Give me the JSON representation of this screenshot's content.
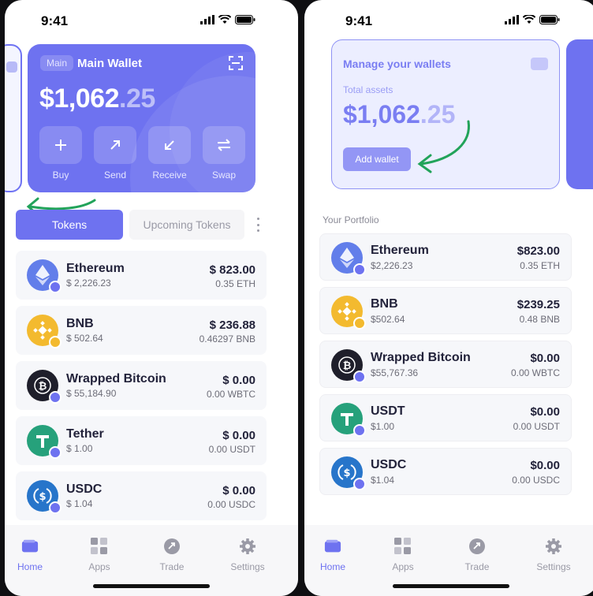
{
  "status": {
    "time": "9:41"
  },
  "left": {
    "wallet": {
      "tag": "Main",
      "name": "Main Wallet",
      "balance_main": "$1,062",
      "balance_cents": ".25",
      "actions": [
        {
          "label": "Buy",
          "icon": "plus-icon"
        },
        {
          "label": "Send",
          "icon": "arrow-up-right-icon"
        },
        {
          "label": "Receive",
          "icon": "arrow-down-left-icon"
        },
        {
          "label": "Swap",
          "icon": "swap-icon"
        }
      ]
    },
    "tabs": {
      "active": "Tokens",
      "inactive": "Upcoming Tokens"
    },
    "tokens": [
      {
        "name": "Ethereum",
        "fiat": "$ 2,226.23",
        "value": "$ 823.00",
        "qty": "0.35 ETH",
        "color": "#627eea"
      },
      {
        "name": "BNB",
        "fiat": "$ 502.64",
        "value": "$ 236.88",
        "qty": "0.46297 BNB",
        "color": "#f3ba2f"
      },
      {
        "name": "Wrapped Bitcoin",
        "fiat": "$ 55,184.90",
        "value": "$ 0.00",
        "qty": "0.00 WBTC",
        "color": "#1f1f2b"
      },
      {
        "name": "Tether",
        "fiat": "$ 1.00",
        "value": "$ 0.00",
        "qty": "0.00 USDT",
        "color": "#26a17b"
      },
      {
        "name": "USDC",
        "fiat": "$ 1.04",
        "value": "$ 0.00",
        "qty": "0.00 USDC",
        "color": "#2775ca"
      }
    ]
  },
  "right": {
    "card": {
      "title": "Manage your wallets",
      "label": "Total assets",
      "balance_main": "$1,062",
      "balance_cents": ".25",
      "button": "Add wallet"
    },
    "portfolio_label": "Your Portfolio",
    "tokens": [
      {
        "name": "Ethereum",
        "fiat": "$2,226.23",
        "value": "$823.00",
        "qty": "0.35 ETH",
        "color": "#627eea"
      },
      {
        "name": "BNB",
        "fiat": "$502.64",
        "value": "$239.25",
        "qty": "0.48 BNB",
        "color": "#f3ba2f"
      },
      {
        "name": "Wrapped Bitcoin",
        "fiat": "$55,767.36",
        "value": "$0.00",
        "qty": "0.00 WBTC",
        "color": "#1f1f2b"
      },
      {
        "name": "USDT",
        "fiat": "$1.00",
        "value": "$0.00",
        "qty": "0.00 USDT",
        "color": "#26a17b"
      },
      {
        "name": "USDC",
        "fiat": "$1.04",
        "value": "$0.00",
        "qty": "0.00 USDC",
        "color": "#2775ca"
      }
    ]
  },
  "tabbar": [
    {
      "label": "Home",
      "icon": "wallet-icon",
      "active": true
    },
    {
      "label": "Apps",
      "icon": "apps-grid-icon",
      "active": false
    },
    {
      "label": "Trade",
      "icon": "trade-icon",
      "active": false
    },
    {
      "label": "Settings",
      "icon": "gear-icon",
      "active": false
    }
  ],
  "colors": {
    "accent": "#6e72f0",
    "arrow": "#22a35a"
  }
}
